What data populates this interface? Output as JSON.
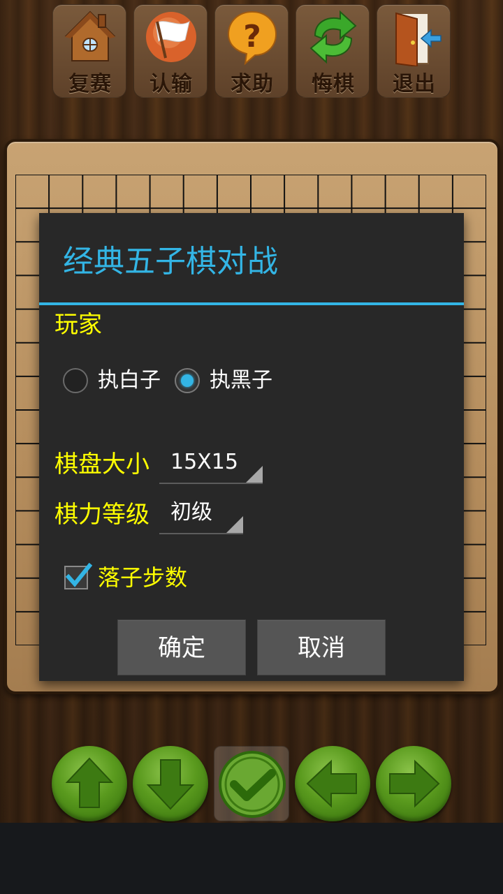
{
  "toolbar": {
    "buttons": [
      {
        "label": "复赛",
        "icon": "house-icon"
      },
      {
        "label": "认输",
        "icon": "white-flag-icon"
      },
      {
        "label": "求助",
        "icon": "question-icon"
      },
      {
        "label": "悔棋",
        "icon": "undo-arrows-icon"
      },
      {
        "label": "退出",
        "icon": "exit-door-icon"
      }
    ]
  },
  "dialog": {
    "title": "经典五子棋对战",
    "player_label": "玩家",
    "radio_options": [
      {
        "label": "执白子",
        "checked": false
      },
      {
        "label": "执黑子",
        "checked": true
      }
    ],
    "board_size_label": "棋盘大小",
    "board_size_value": "15X15",
    "level_label": "棋力等级",
    "level_value": "初级",
    "show_steps_label": "落子步数",
    "show_steps_checked": true,
    "ok_label": "确定",
    "cancel_label": "取消"
  },
  "controls": [
    {
      "icon": "arrow-up-icon"
    },
    {
      "icon": "arrow-down-icon"
    },
    {
      "icon": "checkmark-icon"
    },
    {
      "icon": "arrow-left-icon"
    },
    {
      "icon": "arrow-right-icon"
    }
  ],
  "colors": {
    "accent": "#33b5e5",
    "label_yellow": "#ffff00",
    "dialog_bg": "#282828",
    "button_gray": "#555555"
  }
}
